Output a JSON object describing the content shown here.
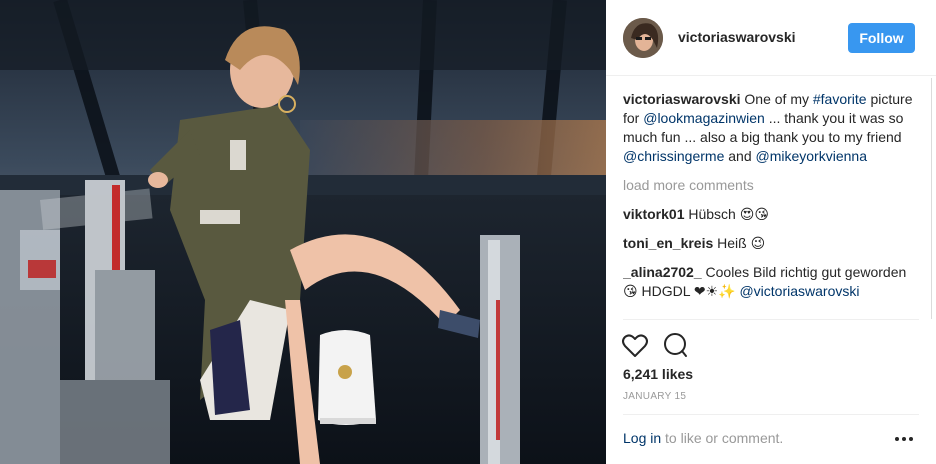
{
  "post": {
    "username": "victoriaswarovski",
    "follow_label": "Follow",
    "caption": {
      "username": "victoriaswarovski",
      "text_1": " One of my ",
      "hashtag": "#favorite",
      "text_2": " picture for ",
      "mention_1": "@lookmagazinwien",
      "text_3": " ... thank you it was so much fun ... also a big thank you to my friend ",
      "mention_2": "@chrissingerme",
      "text_4": " and ",
      "mention_3": "@mikeyorkvienna"
    },
    "load_more_label": "load more comments",
    "comments": [
      {
        "username": "viktork01",
        "text": "Hübsch 😍😘"
      },
      {
        "username": "toni_en_kreis",
        "text": "Heiß 😉"
      },
      {
        "username": "_alina2702_",
        "text": "Cooles Bild richtig gut geworden 😘 HDGDL ❤☀✨",
        "mention": "@victoriaswarovski"
      }
    ],
    "likes": "6,241 likes",
    "date": "JANUARY 15",
    "login_link": "Log in",
    "login_suffix": " to like or comment.",
    "more_label": "···"
  },
  "icons": {
    "like": "heart-icon",
    "comment": "comment-icon",
    "options": "more-options-icon"
  }
}
